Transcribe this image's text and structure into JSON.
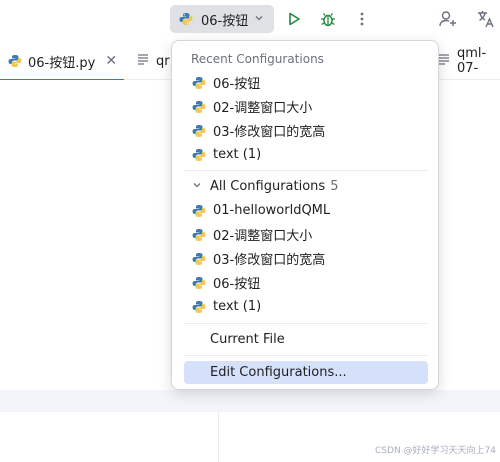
{
  "toolbar": {
    "run_config_label": "06-按钮"
  },
  "tabs": [
    {
      "label": "06-按钮.py"
    },
    {
      "label": "qr"
    },
    {
      "label": "qml-07-"
    }
  ],
  "popup": {
    "recent_header": "Recent Configurations",
    "recent_items": [
      "06-按钮",
      "02-调整窗口大小",
      "03-修改窗口的宽高",
      "text (1)"
    ],
    "all_header": "All Configurations",
    "all_count": "5",
    "all_items": [
      "01-helloworldQML",
      "02-调整窗口大小",
      "03-修改窗口的宽高",
      "06-按钮",
      "text (1)"
    ],
    "current_file": "Current File",
    "edit_configurations": "Edit Configurations..."
  },
  "watermark": "CSDN @好好学习天天向上74",
  "colors": {
    "accent": "#3574f0",
    "run_green": "#208a3c",
    "selection": "#d5e1fa"
  }
}
